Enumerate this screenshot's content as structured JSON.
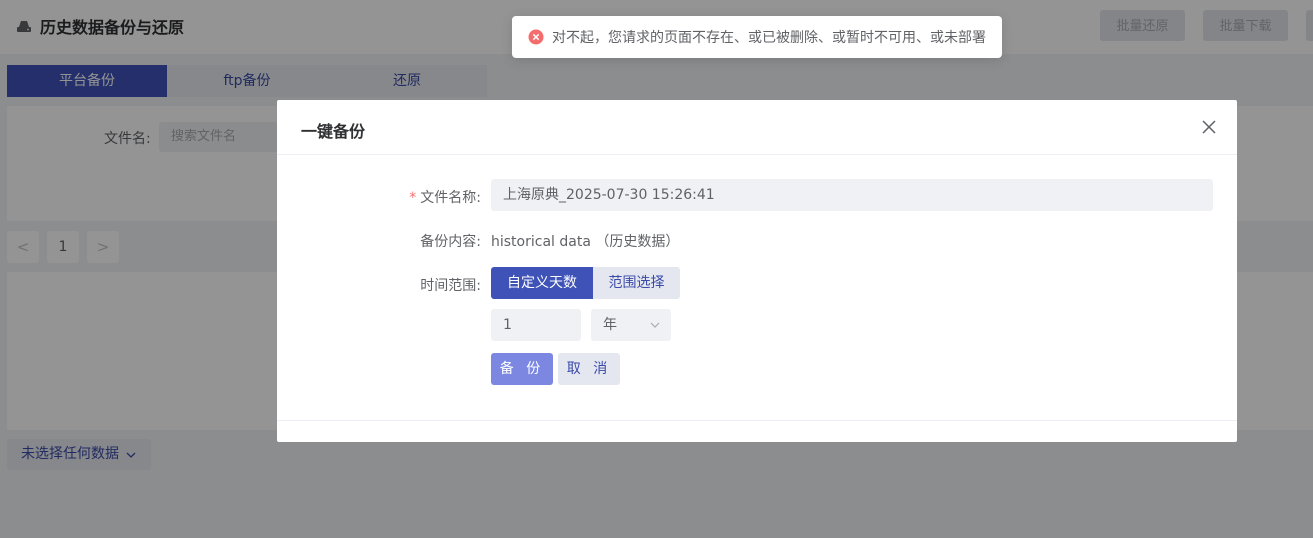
{
  "header": {
    "title": "历史数据备份与还原",
    "batch_restore": "批量还原",
    "batch_download": "批量下载"
  },
  "tabs": [
    {
      "label": "平台备份",
      "active": true
    },
    {
      "label": "ftp备份",
      "active": false
    },
    {
      "label": "还原",
      "active": false
    }
  ],
  "search": {
    "label": "文件名:",
    "placeholder": "搜索文件名"
  },
  "pagination": {
    "prev": "<",
    "page": "1",
    "next": ">"
  },
  "selection": {
    "label": "未选择任何数据"
  },
  "toast": {
    "type": "error",
    "message": "对不起，您请求的页面不存在、或已被删除、或暂时不可用、或未部署"
  },
  "dialog": {
    "title": "一键备份",
    "file_name_label": "文件名称:",
    "file_name_value": "上海原典_2025-07-30 15:26:41",
    "content_label": "备份内容:",
    "content_value": "historical data （历史数据）",
    "time_range_label": "时间范围:",
    "mode_custom": "自定义天数",
    "mode_range": "范围选择",
    "amount_value": "1",
    "unit_value": "年",
    "backup_button": "备 份",
    "cancel_button": "取 消"
  },
  "colors": {
    "primary": "#3e52b8",
    "primary_light": "#7b87e0",
    "error": "#f56c6c"
  }
}
